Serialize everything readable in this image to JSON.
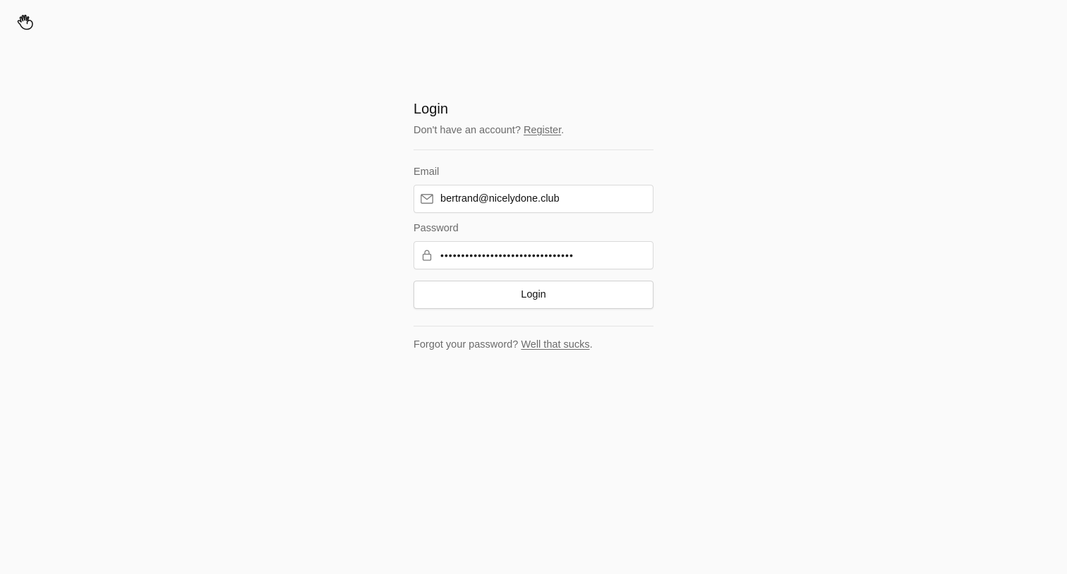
{
  "logo": {
    "icon": "waving-hand-icon"
  },
  "login": {
    "title": "Login",
    "register_prompt": "Don't have an account?",
    "register_link": "Register",
    "register_suffix": "."
  },
  "form": {
    "email_label": "Email",
    "email_value": "bertrand@nicelydone.club",
    "email_icon": "mail-icon",
    "password_label": "Password",
    "password_value": "••••••••••••••••••••••••••••••••",
    "password_icon": "lock-icon",
    "submit_label": "Login"
  },
  "footer": {
    "forgot_prompt": "Forgot your password?",
    "forgot_link": "Well that sucks",
    "forgot_suffix": "."
  }
}
